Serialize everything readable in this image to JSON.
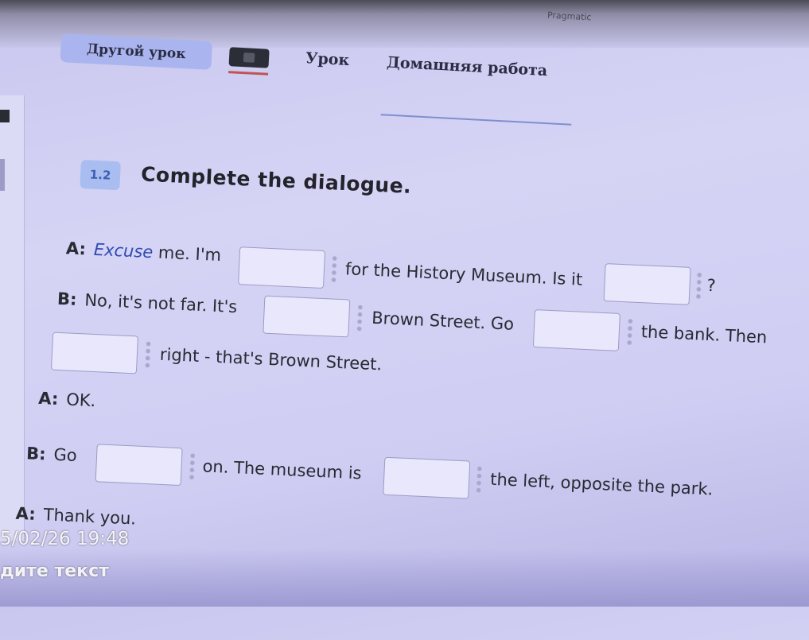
{
  "top_bar": {
    "user_label": "Pragmatic"
  },
  "nav": {
    "other_lesson": "Другой урок",
    "tabs": [
      {
        "label": "Урок"
      },
      {
        "label": "Домашняя работа"
      }
    ]
  },
  "exercise": {
    "number": "1.2",
    "title": "Complete the dialogue."
  },
  "dialogue": {
    "line1": {
      "speaker": "A:",
      "word": "Excuse",
      "text_a": "me. I'm",
      "text_b": "for the History Museum. Is it",
      "text_c": "?"
    },
    "line2": {
      "speaker": "B:",
      "text_a": "No, it's not far. It's",
      "text_b": "Brown Street. Go",
      "text_c": "the bank. Then"
    },
    "line3": {
      "text": "right - that's Brown Street."
    },
    "line4": {
      "speaker": "A:",
      "text": "OK."
    },
    "line5": {
      "speaker": "B:",
      "text_a": "Go",
      "text_b": "on. The museum is",
      "text_c": "the left, opposite the park."
    },
    "line6": {
      "speaker": "A:",
      "text": "Thank you."
    }
  },
  "overlay": {
    "timestamp": "5/02/26 19:48",
    "input_placeholder": "дите текст"
  }
}
